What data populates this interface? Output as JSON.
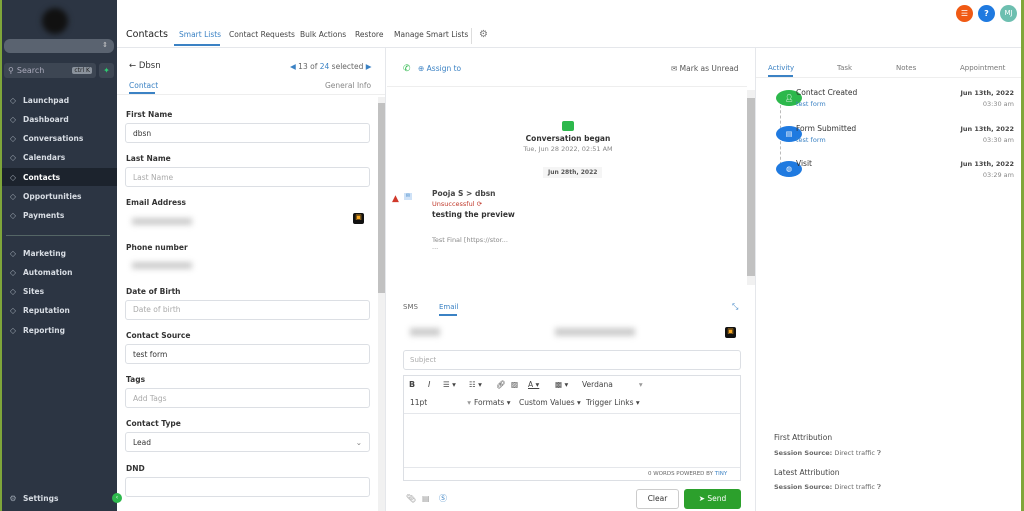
{
  "sidebar": {
    "search_placeholder": "Search",
    "search_shortcut": "ctrl K",
    "items": [
      {
        "label": "Launchpad",
        "icon": "rocket-icon"
      },
      {
        "label": "Dashboard",
        "icon": "grid-icon"
      },
      {
        "label": "Conversations",
        "icon": "chat-icon"
      },
      {
        "label": "Calendars",
        "icon": "calendar-icon"
      },
      {
        "label": "Contacts",
        "icon": "contacts-icon",
        "active": true
      },
      {
        "label": "Opportunities",
        "icon": "funnel-icon"
      },
      {
        "label": "Payments",
        "icon": "payment-icon"
      }
    ],
    "items2": [
      {
        "label": "Marketing",
        "icon": "send-icon"
      },
      {
        "label": "Automation",
        "icon": "play-icon"
      },
      {
        "label": "Sites",
        "icon": "site-icon"
      },
      {
        "label": "Reputation",
        "icon": "star-icon"
      },
      {
        "label": "Reporting",
        "icon": "chart-icon"
      }
    ],
    "settings": "Settings"
  },
  "header": {
    "title": "Contacts",
    "tabs": [
      "Smart Lists",
      "Contact Requests",
      "Bulk Actions",
      "Restore",
      "Manage Smart Lists"
    ],
    "avatar": "MJ"
  },
  "contact": {
    "name": "Dbsn",
    "pager_current": "13 of",
    "pager_total": "24",
    "pager_suffix": "selected",
    "tabs": [
      "Contact",
      "General Info"
    ],
    "fields": [
      {
        "label": "First Name",
        "value": "dbsn"
      },
      {
        "label": "Last Name",
        "placeholder": "Last Name"
      },
      {
        "label": "Email Address"
      },
      {
        "label": "Phone number"
      },
      {
        "label": "Date of Birth",
        "placeholder": "Date of birth"
      },
      {
        "label": "Contact Source",
        "value": "test form"
      },
      {
        "label": "Tags",
        "placeholder": "Add Tags"
      },
      {
        "label": "Contact Type",
        "value": "Lead"
      },
      {
        "label": "DND"
      }
    ]
  },
  "conversation": {
    "assign": "Assign to",
    "mark_unread": "Mark as Unread",
    "began": "Conversation began",
    "began_time": "Tue, Jun 28 2022, 02:51 AM",
    "date_chip": "Jun 28th, 2022",
    "from": "Pooja S > dbsn",
    "status": "Unsuccessful",
    "subject": "testing the preview",
    "body": "Test Final [https://stor...",
    "ellipsis": "...",
    "tabs": [
      "SMS",
      "Email"
    ],
    "subject_placeholder": "Subject",
    "font": "Verdana",
    "size": "11pt",
    "formats": "Formats",
    "custom_values": "Custom Values",
    "trigger_links": "Trigger Links",
    "footer": "0 WORDS POWERED BY",
    "tiny": "TINY",
    "clear": "Clear",
    "send": "Send"
  },
  "activity": {
    "tabs": [
      "Activity",
      "Task",
      "Notes",
      "Appointment"
    ],
    "items": [
      {
        "title": "Contact Created",
        "sub": "test form",
        "date": "Jun 13th, 2022",
        "time": "03:30 am",
        "color": "#2db84c"
      },
      {
        "title": "Form Submitted",
        "sub": "test form",
        "date": "Jun 13th, 2022",
        "time": "03:30 am",
        "color": "#1f7ae0"
      },
      {
        "title": "Visit",
        "sub": "",
        "date": "Jun 13th, 2022",
        "time": "03:29 am",
        "color": "#1f7ae0"
      }
    ],
    "first_attr": "First Attribution",
    "latest_attr": "Latest Attribution",
    "session_label": "Session Source:",
    "session_value": "Direct traffic"
  }
}
